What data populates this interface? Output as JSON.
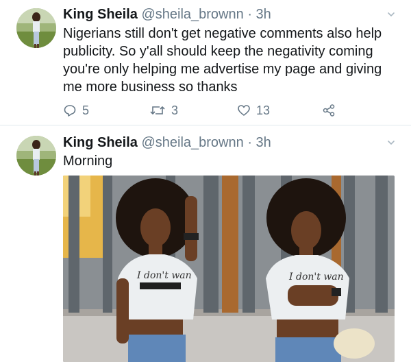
{
  "tweets": [
    {
      "author_name": "King Sheila",
      "handle": "@sheila_brownn",
      "separator": "·",
      "time": "3h",
      "text": "Nigerians still don't get negative comments also help publicity. So y'all should keep the negativity coming you're only helping me advertise my page and giving me more business so thanks",
      "replies": "5",
      "retweets": "3",
      "likes": "13"
    },
    {
      "author_name": "King Sheila",
      "handle": "@sheila_brownn",
      "separator": "·",
      "time": "3h",
      "text": "Morning",
      "photo_shirt_text_left": "I don't wan",
      "photo_shirt_text_right": "I don't wan"
    }
  ],
  "icons": {
    "caret": "chevron-down-icon",
    "reply": "reply-icon",
    "retweet": "retweet-icon",
    "like": "heart-icon",
    "share": "share-icon"
  },
  "colors": {
    "text": "#14171a",
    "muted": "#657786",
    "divider": "#e1e8ed"
  }
}
